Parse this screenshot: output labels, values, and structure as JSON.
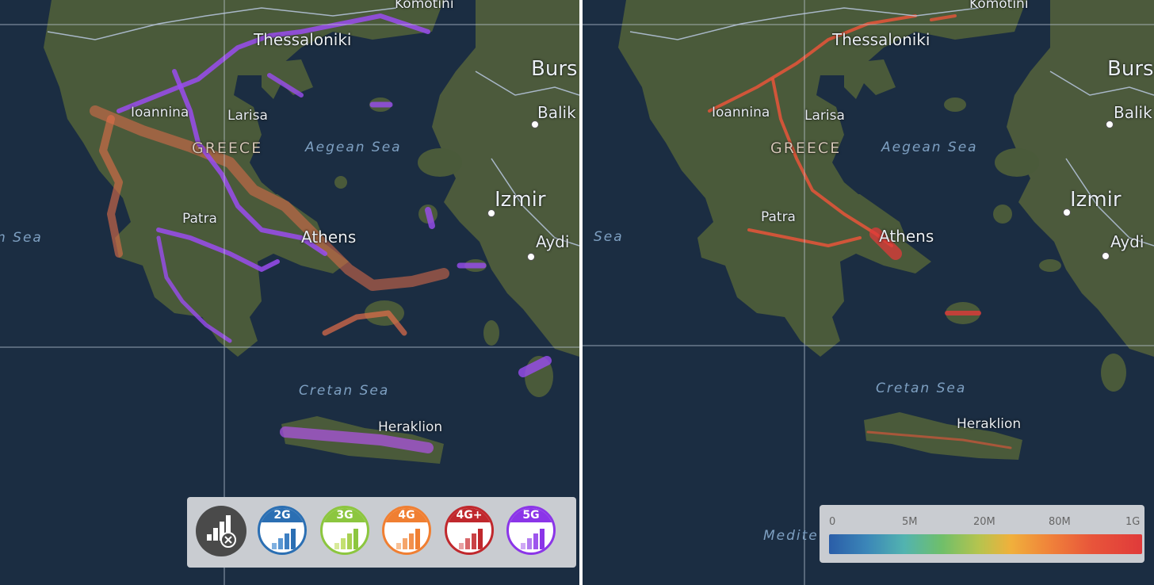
{
  "left_map": {
    "labels": {
      "komotini": "Komotini",
      "thessaloniki": "Thessaloniki",
      "bursa": "Burs",
      "balikesir": "Balik",
      "ioannina": "Ioannina",
      "larisa": "Larisa",
      "greece": "GREECE",
      "aegean": "Aegean Sea",
      "izmir": "Izmir",
      "patra": "Patra",
      "athens": "Athens",
      "aydin": "Aydi",
      "ionian": "n Sea",
      "cretan": "Cretan Sea",
      "heraklion": "Heraklion"
    },
    "legend": {
      "items": [
        {
          "label": "",
          "icon": "no-signal-icon",
          "color": "#4a4a4a"
        },
        {
          "label": "2G",
          "icon": "signal-bars-icon",
          "color": "#2b6fb3"
        },
        {
          "label": "3G",
          "icon": "signal-bars-icon",
          "color": "#8cc63f"
        },
        {
          "label": "4G",
          "icon": "signal-bars-icon",
          "color": "#f07f32"
        },
        {
          "label": "4G+",
          "icon": "signal-bars-icon",
          "color": "#c0282d"
        },
        {
          "label": "5G",
          "icon": "signal-bars-icon",
          "color": "#8b35e8"
        }
      ]
    }
  },
  "right_map": {
    "labels": {
      "komotini": "Komotini",
      "thessaloniki": "Thessaloniki",
      "bursa": "Burs",
      "balikesir": "Balik",
      "ioannina": "Ioannina",
      "larisa": "Larisa",
      "greece": "GREECE",
      "aegean": "Aegean Sea",
      "izmir": "Izmir",
      "patra": "Patra",
      "athens": "Athens",
      "aydin": "Aydi",
      "ionian": "Sea",
      "cretan": "Cretan Sea",
      "heraklion": "Heraklion",
      "mediterranean": "Medite"
    },
    "speed_legend": {
      "ticks": [
        "0",
        "5M",
        "20M",
        "80M",
        "1G"
      ],
      "colors": [
        "#2a5da8",
        "#52b3b0",
        "#6fbf6a",
        "#f0b03c",
        "#e03a3a"
      ]
    }
  }
}
